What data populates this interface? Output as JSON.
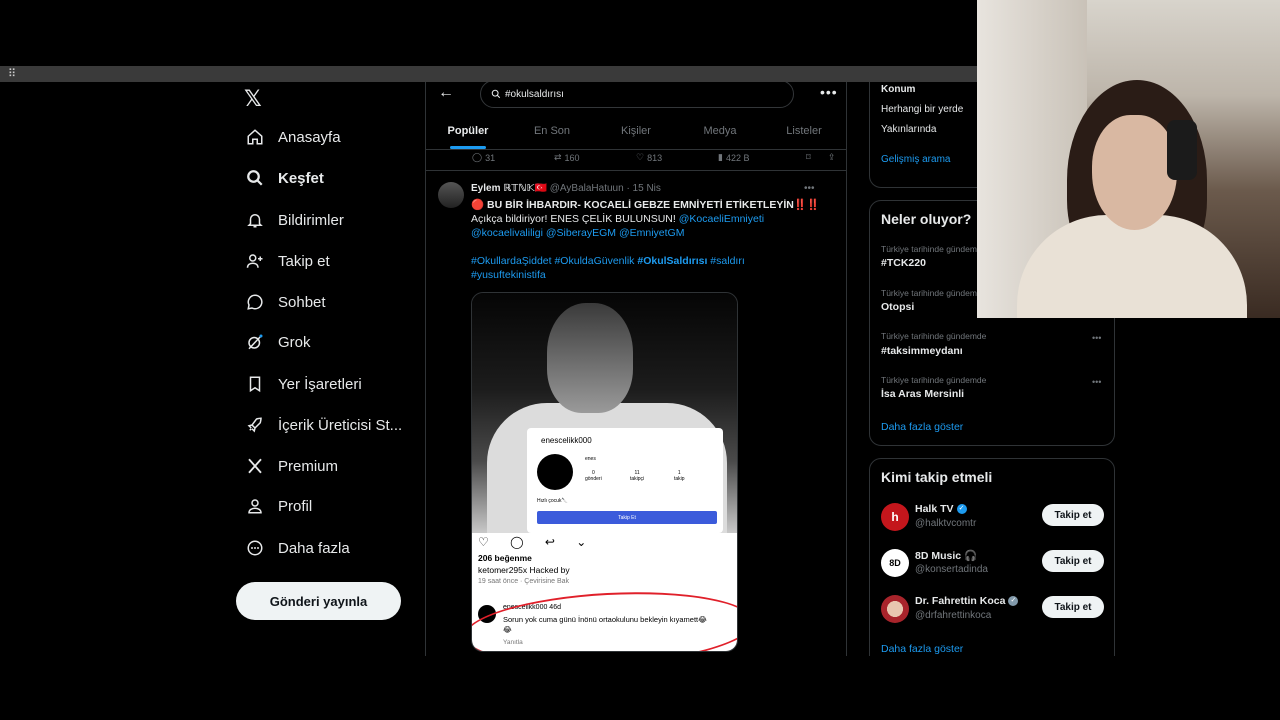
{
  "nav": {
    "logo": "𝕏",
    "items": [
      {
        "label": "Anasayfa",
        "icon": "home-icon",
        "active": false
      },
      {
        "label": "Keşfet",
        "icon": "search-icon",
        "active": true
      },
      {
        "label": "Bildirimler",
        "icon": "bell-icon",
        "active": false
      },
      {
        "label": "Takip et",
        "icon": "add-user-icon",
        "active": false
      },
      {
        "label": "Sohbet",
        "icon": "chat-icon",
        "active": false
      },
      {
        "label": "Grok",
        "icon": "grok-icon",
        "active": false
      },
      {
        "label": "Yer İşaretleri",
        "icon": "bookmark-icon",
        "active": false
      },
      {
        "label": "İçerik Üreticisi St...",
        "icon": "rocket-icon",
        "active": false
      },
      {
        "label": "Premium",
        "icon": "x-premium-icon",
        "active": false
      },
      {
        "label": "Profil",
        "icon": "person-icon",
        "active": false
      },
      {
        "label": "Daha fazla",
        "icon": "more-circle-icon",
        "active": false
      }
    ],
    "post_button": "Gönderi yayınla"
  },
  "search": {
    "back": "←",
    "query": "#okulsaldırısı",
    "more": "•••"
  },
  "tabs": [
    "Popüler",
    "En Son",
    "Kişiler",
    "Medya",
    "Listeler"
  ],
  "prev_tweet_actions": {
    "replies": "31",
    "reposts": "160",
    "likes": "813",
    "views": "422 B"
  },
  "tweet": {
    "name": "Eylem ℝ𝕋ℕ𝕂🇹🇷",
    "handle": "@AyBalaHatuun · 15 Nis",
    "more": "•••",
    "line1": "🔴 BU BİR İHBARDIR- KOCAELİ GEBZE EMNİYETİ ETİKETLEYİN‼️‼️",
    "line2_plain": "Açıkça bildiriyor! ENES ÇELİK BULUNSUN! ",
    "line2_link": "@KocaeliEmniyeti",
    "line3": "@kocaelivaliligi @SiberayEGM @EmniyetGM",
    "line4_a": "#OkullardaŞiddet #OkuldaGüvenlik ",
    "line4_b": "#OkulSaldırısı",
    "line4_c": " #saldırı",
    "line5": "#yusuftekinistifa"
  },
  "media": {
    "profile_username": "enescelikk000",
    "profile_name": "enes",
    "stats": [
      {
        "n": "0",
        "label": "gönderi"
      },
      {
        "n": "11",
        "label": "takipçi"
      },
      {
        "n": "1",
        "label": "takip"
      }
    ],
    "bio": "Hızlı çocuk🔪",
    "follow_btn": "Takip Et",
    "ig_icons": "♡ ◯ ↩ ⌄",
    "likes": "206 beğenme",
    "caption": "ketomer295x Hacked by",
    "meta": "19 saat önce · Çevirisine Bak",
    "comment_user": "enescelikk000  46d",
    "comment_text": "Sorun yok cuma günü İnönü ortaokulunu bekleyin kıyamett😂😂",
    "reply": "Yanıtla"
  },
  "right": {
    "location_title": "Konum",
    "location_opt1": "Herhangi bir yerde",
    "location_opt2": "Yakınlarında",
    "advanced": "Gelişmiş arama",
    "trends_title": "Neler oluyor?",
    "trends": [
      {
        "ctx": "Türkiye tarihinde gündemde",
        "name": "#TCK220"
      },
      {
        "ctx": "Türkiye tarihinde gündemde",
        "name": "Otopsi"
      },
      {
        "ctx": "Türkiye tarihinde gündemde",
        "name": "#taksimmeydanı"
      },
      {
        "ctx": "Türkiye tarihinde gündemde",
        "name": "İsa Aras Mersinli"
      }
    ],
    "show_more": "Daha fazla göster",
    "wtf_title": "Kimi takip etmeli",
    "wtf": [
      {
        "name": "Halk TV",
        "handle": "@halktvcomtr",
        "verified": "blue",
        "av": "h"
      },
      {
        "name": "8D Music 🎧",
        "handle": "@konsertadinda",
        "verified": "",
        "av": "8D"
      },
      {
        "name": "Dr. Fahrettin Koca",
        "handle": "@drfahrettinkoca",
        "verified": "grey",
        "av": ""
      }
    ],
    "follow": "Takip et",
    "wtf_more": "Daha fazla göster"
  }
}
